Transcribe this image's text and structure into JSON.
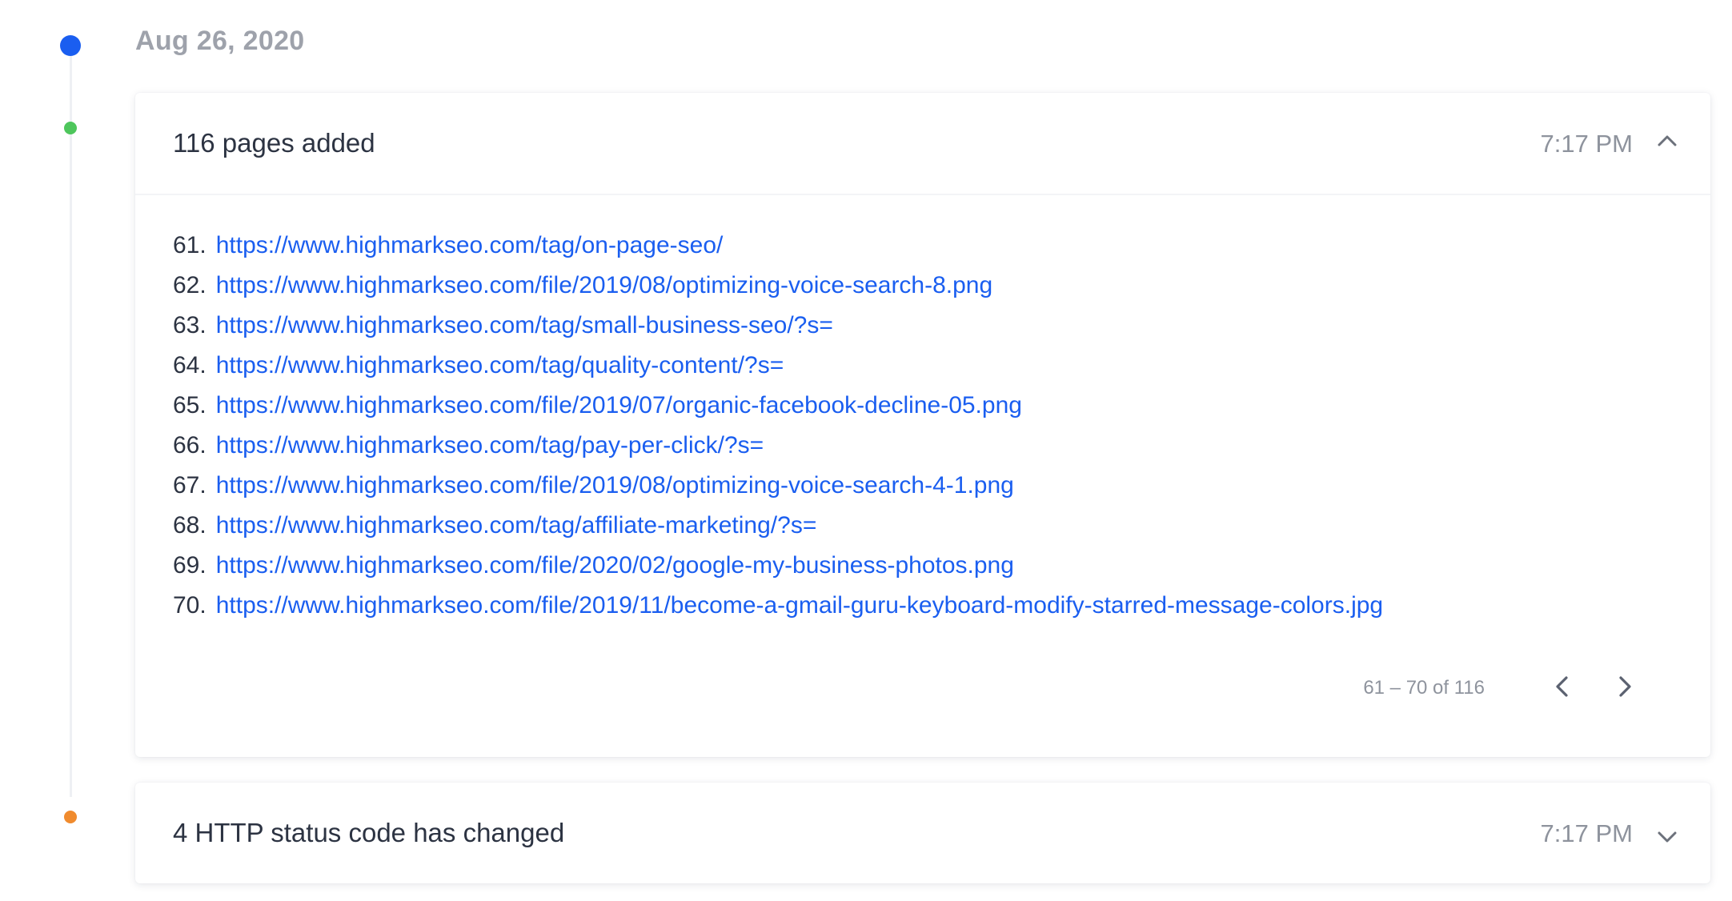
{
  "timeline": {
    "date": "Aug 26, 2020",
    "colors": {
      "date_dot": "#1a5ef0",
      "added_dot": "#4ec65c",
      "changed_dot": "#f08b2e",
      "link": "#1a5ef0"
    }
  },
  "pages_added": {
    "title": "116 pages added",
    "time": "7:17 PM",
    "expanded": true,
    "toggle_icon": "chevron-up-icon",
    "items": [
      {
        "num": "61.",
        "url": "https://www.highmarkseo.com/tag/on-page-seo/"
      },
      {
        "num": "62.",
        "url": "https://www.highmarkseo.com/file/2019/08/optimizing-voice-search-8.png"
      },
      {
        "num": "63.",
        "url": "https://www.highmarkseo.com/tag/small-business-seo/?s="
      },
      {
        "num": "64.",
        "url": "https://www.highmarkseo.com/tag/quality-content/?s="
      },
      {
        "num": "65.",
        "url": "https://www.highmarkseo.com/file/2019/07/organic-facebook-decline-05.png"
      },
      {
        "num": "66.",
        "url": "https://www.highmarkseo.com/tag/pay-per-click/?s="
      },
      {
        "num": "67.",
        "url": "https://www.highmarkseo.com/file/2019/08/optimizing-voice-search-4-1.png"
      },
      {
        "num": "68.",
        "url": "https://www.highmarkseo.com/tag/affiliate-marketing/?s="
      },
      {
        "num": "69.",
        "url": "https://www.highmarkseo.com/file/2020/02/google-my-business-photos.png"
      },
      {
        "num": "70.",
        "url": "https://www.highmarkseo.com/file/2019/11/become-a-gmail-guru-keyboard-modify-starred-message-colors.jpg"
      }
    ],
    "pagination": {
      "range": "61 – 70 of 116",
      "prev_icon": "chevron-left-icon",
      "next_icon": "chevron-right-icon"
    }
  },
  "status_changed": {
    "title": "4 HTTP status code has changed",
    "time": "7:17 PM",
    "expanded": false,
    "toggle_icon": "chevron-down-icon"
  }
}
